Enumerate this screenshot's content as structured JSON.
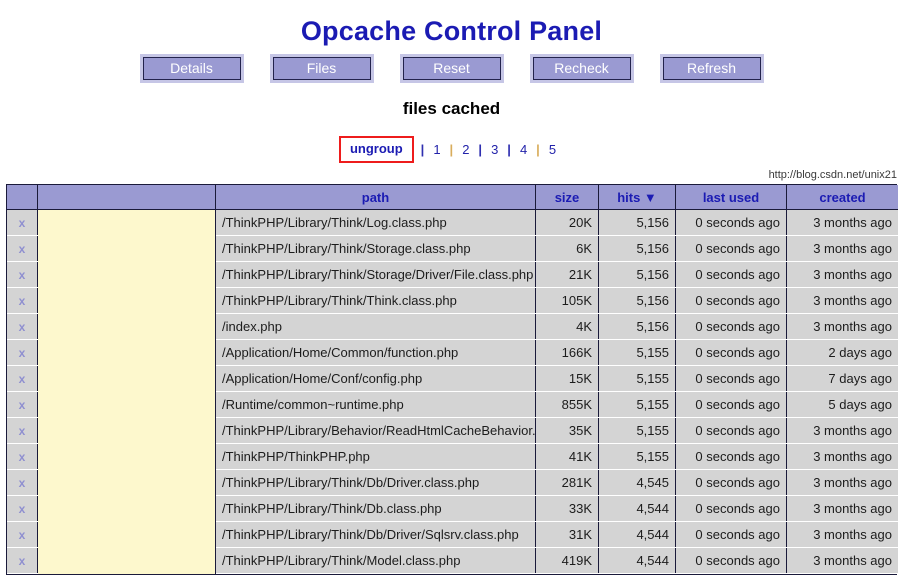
{
  "header": {
    "title": "Opcache Control Panel"
  },
  "toolbar": {
    "buttons": [
      {
        "label": "Details",
        "name": "details-button"
      },
      {
        "label": "Files",
        "name": "files-button"
      },
      {
        "label": "Reset",
        "name": "reset-button"
      },
      {
        "label": "Recheck",
        "name": "recheck-button"
      },
      {
        "label": "Refresh",
        "name": "refresh-button"
      }
    ]
  },
  "section": {
    "subheading": "files cached"
  },
  "pagination": {
    "ungroup_label": "ungroup",
    "separator": "|",
    "pages": [
      "1",
      "2",
      "3",
      "4",
      "5"
    ]
  },
  "watermark": {
    "text": "http://blog.csdn.net/unix21"
  },
  "table": {
    "columns": {
      "delete": "",
      "group": "",
      "path": "path",
      "size": "size",
      "hits": "hits ▼",
      "last_used": "last used",
      "created": "created"
    },
    "delete_glyph": "x",
    "rows": [
      {
        "path": "/ThinkPHP/Library/Think/Log.class.php",
        "size": "20K",
        "hits": "5,156",
        "last_used": "0 seconds ago",
        "created": "3 months ago"
      },
      {
        "path": "/ThinkPHP/Library/Think/Storage.class.php",
        "size": "6K",
        "hits": "5,156",
        "last_used": "0 seconds ago",
        "created": "3 months ago"
      },
      {
        "path": "/ThinkPHP/Library/Think/Storage/Driver/File.class.php",
        "size": "21K",
        "hits": "5,156",
        "last_used": "0 seconds ago",
        "created": "3 months ago"
      },
      {
        "path": "/ThinkPHP/Library/Think/Think.class.php",
        "size": "105K",
        "hits": "5,156",
        "last_used": "0 seconds ago",
        "created": "3 months ago"
      },
      {
        "path": "/index.php",
        "size": "4K",
        "hits": "5,156",
        "last_used": "0 seconds ago",
        "created": "3 months ago"
      },
      {
        "path": "/Application/Home/Common/function.php",
        "size": "166K",
        "hits": "5,155",
        "last_used": "0 seconds ago",
        "created": "2 days ago"
      },
      {
        "path": "/Application/Home/Conf/config.php",
        "size": "15K",
        "hits": "5,155",
        "last_used": "0 seconds ago",
        "created": "7 days ago"
      },
      {
        "path": "/Runtime/common~runtime.php",
        "size": "855K",
        "hits": "5,155",
        "last_used": "0 seconds ago",
        "created": "5 days ago"
      },
      {
        "path": "/ThinkPHP/Library/Behavior/ReadHtmlCacheBehavior.class.php",
        "size": "35K",
        "hits": "5,155",
        "last_used": "0 seconds ago",
        "created": "3 months ago"
      },
      {
        "path": "/ThinkPHP/ThinkPHP.php",
        "size": "41K",
        "hits": "5,155",
        "last_used": "0 seconds ago",
        "created": "3 months ago"
      },
      {
        "path": "/ThinkPHP/Library/Think/Db/Driver.class.php",
        "size": "281K",
        "hits": "4,545",
        "last_used": "0 seconds ago",
        "created": "3 months ago"
      },
      {
        "path": "/ThinkPHP/Library/Think/Db.class.php",
        "size": "33K",
        "hits": "4,544",
        "last_used": "0 seconds ago",
        "created": "3 months ago"
      },
      {
        "path": "/ThinkPHP/Library/Think/Db/Driver/Sqlsrv.class.php",
        "size": "31K",
        "hits": "4,544",
        "last_used": "0 seconds ago",
        "created": "3 months ago"
      },
      {
        "path": "/ThinkPHP/Library/Think/Model.class.php",
        "size": "419K",
        "hits": "4,544",
        "last_used": "0 seconds ago",
        "created": "3 months ago"
      }
    ]
  },
  "colors": {
    "title": "#1b1bb3",
    "button_fill": "#9a9ad2",
    "header_fill": "#9a9ad2",
    "row_fill": "#d4d4d4",
    "group_fill": "#fdf8cd",
    "annotation_border": "#ee1c1c"
  }
}
